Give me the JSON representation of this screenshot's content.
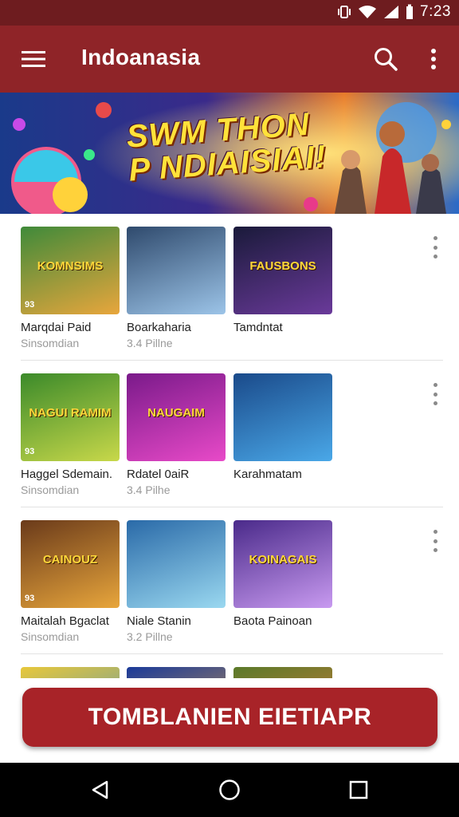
{
  "status": {
    "time": "7:23"
  },
  "appbar": {
    "title": "Indoanasia"
  },
  "banner": {
    "line1": "SWM THON",
    "line2": "P NDIAISIAI!"
  },
  "rows": [
    {
      "cards": [
        {
          "thumb_label": "KOMNSIMS",
          "badge": "93",
          "title": "Marqdai Paid",
          "subtitle": "Sinsomdian",
          "colors": [
            "#3f8a3a",
            "#e8a63c"
          ]
        },
        {
          "thumb_label": "",
          "badge": "",
          "title": "Boarkaharia",
          "subtitle": "3.4 Pillne",
          "colors": [
            "#2f4a6d",
            "#9cc4e8"
          ]
        },
        {
          "thumb_label": "FAUSBONS",
          "badge": "",
          "title": "Tamdntat",
          "subtitle": "",
          "colors": [
            "#1a1a3a",
            "#6a3a9a"
          ]
        }
      ]
    },
    {
      "cards": [
        {
          "thumb_label": "NAGUI RAMIM",
          "badge": "93",
          "title": "Haggel Sdemain.",
          "subtitle": "Sinsomdian",
          "colors": [
            "#3b8a2a",
            "#c8d84a"
          ]
        },
        {
          "thumb_label": "NAUGAIM",
          "badge": "",
          "title": "Rdatel 0aiR",
          "subtitle": "3.4 Pilhe",
          "colors": [
            "#7a1a8a",
            "#e84ac8"
          ]
        },
        {
          "thumb_label": "",
          "badge": "",
          "title": "Karahmatam",
          "subtitle": "",
          "colors": [
            "#1a4a8a",
            "#4aa8e8"
          ]
        }
      ]
    },
    {
      "cards": [
        {
          "thumb_label": "CAINOUZ",
          "badge": "93",
          "title": "Maitalah Bgaclat",
          "subtitle": "Sinsomdian",
          "colors": [
            "#6a3a1a",
            "#e8a63c"
          ]
        },
        {
          "thumb_label": "",
          "badge": "",
          "title": "Niale Stanin",
          "subtitle": "3.2 Pillne",
          "colors": [
            "#2a6aa8",
            "#9ad8f0"
          ]
        },
        {
          "thumb_label": "KOINAGAIS",
          "badge": "",
          "title": "Baota Painoan",
          "subtitle": "",
          "colors": [
            "#4a2a8a",
            "#c89af0"
          ]
        }
      ]
    }
  ],
  "cta": {
    "label": "TOMBLANIEN EIETIAPR"
  }
}
